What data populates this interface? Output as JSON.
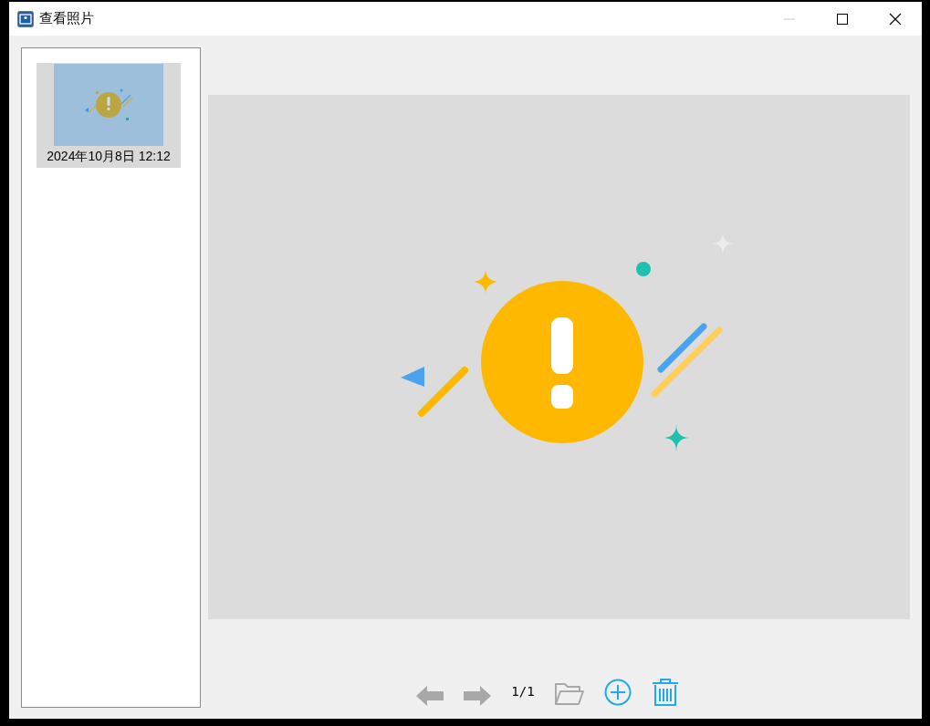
{
  "window": {
    "title": "查看照片",
    "minimize_disabled": true
  },
  "thumbnails": [
    {
      "caption": "2024年10月8日 12:12",
      "selected": true
    }
  ],
  "toolbar": {
    "page": "1/1",
    "buttons": [
      {
        "kind": "prev",
        "disabled": true
      },
      {
        "kind": "next",
        "disabled": true
      },
      {
        "kind": "page"
      },
      {
        "kind": "open",
        "disabled": true
      },
      {
        "kind": "add",
        "disabled": false
      },
      {
        "kind": "delete",
        "disabled": false
      }
    ]
  }
}
